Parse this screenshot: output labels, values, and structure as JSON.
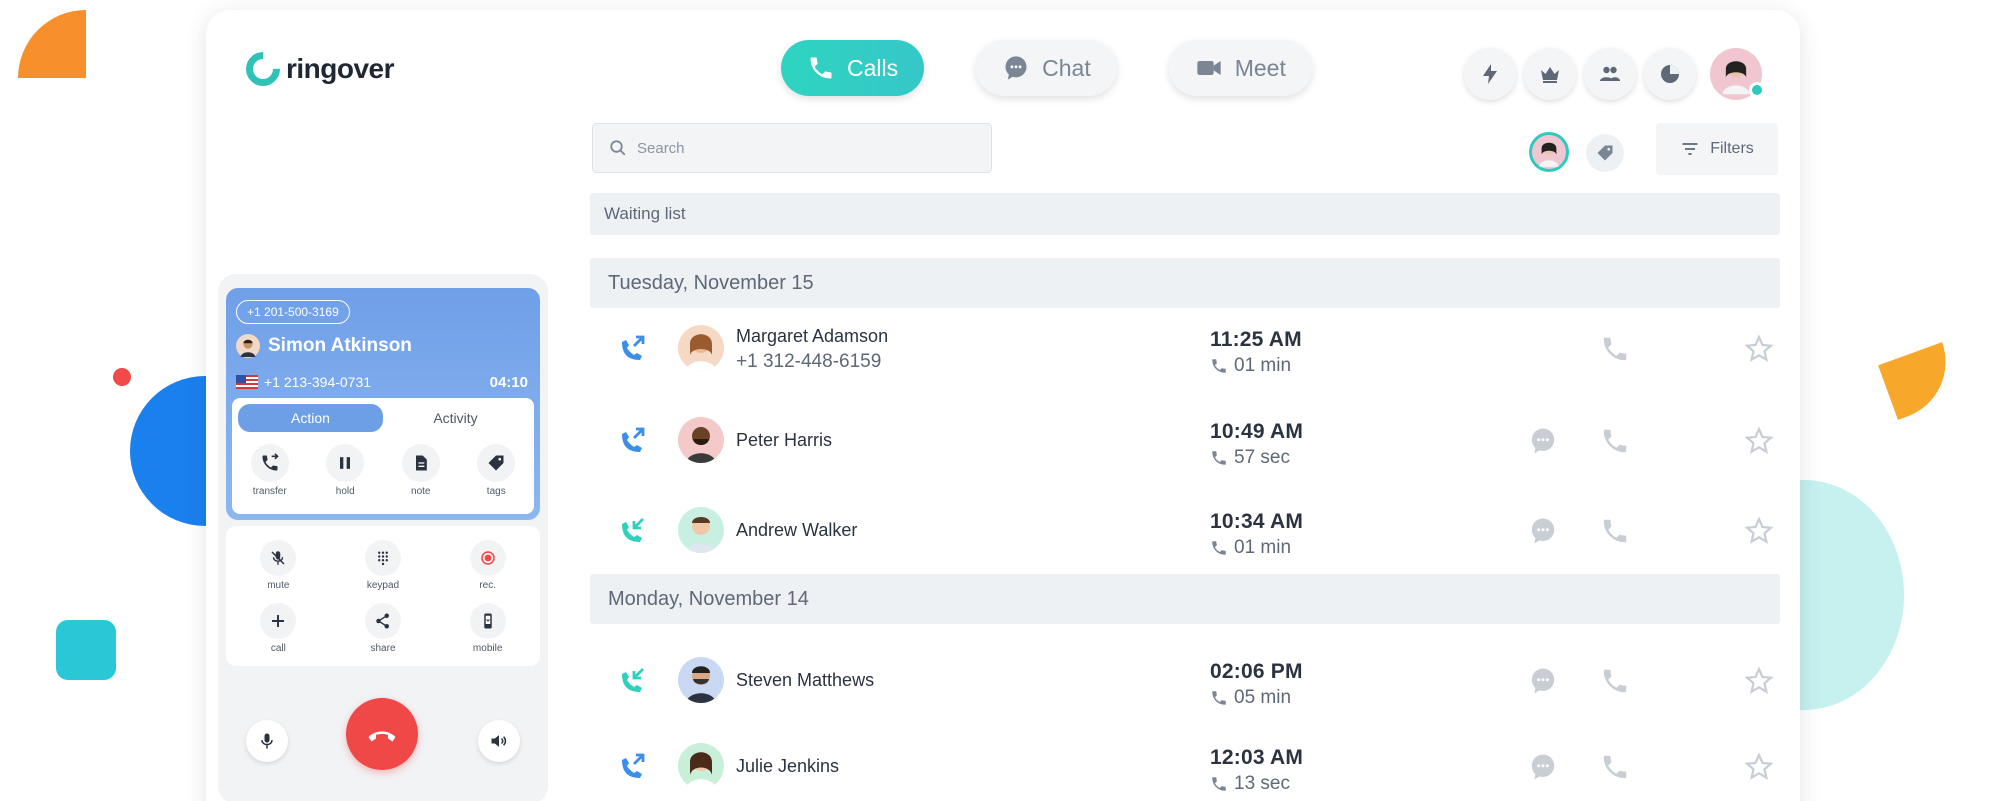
{
  "brand": {
    "name": "ringover",
    "accent": "#2fc2b6"
  },
  "nav": {
    "calls": "Calls",
    "chat": "Chat",
    "meet": "Meet"
  },
  "top_icons": [
    "lightning-icon",
    "crown-icon",
    "team-icon",
    "stats-icon"
  ],
  "search": {
    "placeholder": "Search",
    "value": ""
  },
  "filters": {
    "label": "Filters"
  },
  "waiting_list": "Waiting list",
  "groups": [
    {
      "date": "Tuesday, November 15",
      "calls": [
        {
          "name": "Margaret Adamson",
          "number": "+1 312-448-6159",
          "time": "11:25 AM",
          "duration": "01 min",
          "direction": "outgoing"
        },
        {
          "name": "Peter Harris",
          "time": "10:49 AM",
          "duration": "57 sec",
          "direction": "outgoing"
        },
        {
          "name": "Andrew Walker",
          "time": "10:34 AM",
          "duration": "01 min",
          "direction": "incoming"
        }
      ]
    },
    {
      "date": "Monday, November 14",
      "calls": [
        {
          "name": "Steven Matthews",
          "time": "02:06 PM",
          "duration": "05 min",
          "direction": "incoming"
        },
        {
          "name": "Julie Jenkins",
          "time": "12:03 AM",
          "duration": "13 sec",
          "direction": "outgoing"
        }
      ]
    }
  ],
  "phone": {
    "line_number": "+1 201-500-3169",
    "caller_name": "Simon Atkinson",
    "caller_number": "+1 213-394-0731",
    "timer": "04:10",
    "tabs": [
      "Action",
      "Activity"
    ],
    "actions": [
      "transfer",
      "hold",
      "note",
      "tags"
    ],
    "controls": [
      "mute",
      "keypad",
      "rec.",
      "call",
      "share",
      "mobile"
    ]
  }
}
